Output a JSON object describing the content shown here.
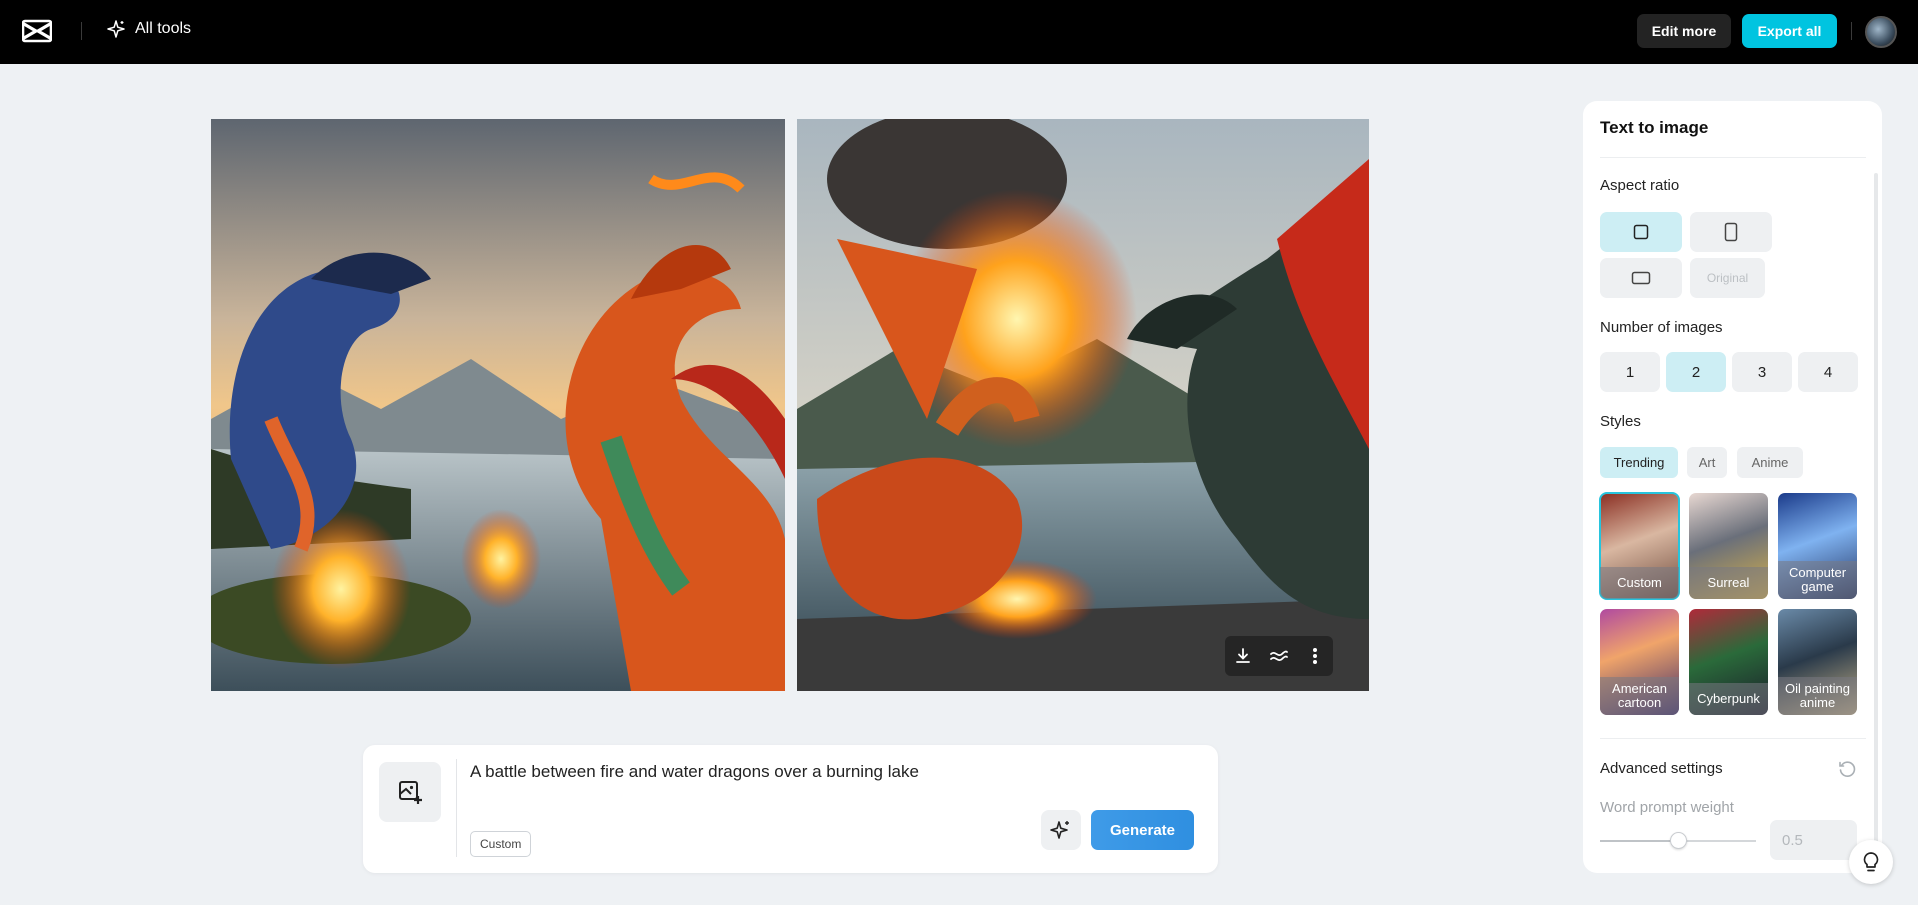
{
  "topbar": {
    "logo_icon": "capcut-logo-icon",
    "all_tools_label": "All tools",
    "edit_more_label": "Edit more",
    "export_all_label": "Export all"
  },
  "prompt": {
    "text": "A battle between fire and water dragons over a burning lake",
    "style_chip": "Custom",
    "generate_label": "Generate"
  },
  "panel": {
    "title": "Text to image",
    "aspect_ratio_label": "Aspect ratio",
    "aspect_options": [
      {
        "icon": "square-ratio-icon",
        "selected": true
      },
      {
        "icon": "portrait-ratio-icon",
        "selected": false
      },
      {
        "icon": "landscape-ratio-icon",
        "selected": false
      },
      {
        "label": "Original",
        "disabled": true
      }
    ],
    "number_of_images_label": "Number of images",
    "numbers": [
      "1",
      "2",
      "3",
      "4"
    ],
    "selected_number": "2",
    "styles_label": "Styles",
    "style_tabs": [
      "Trending",
      "Art",
      "Anime"
    ],
    "selected_tab": "Trending",
    "styles": [
      {
        "label": "Custom",
        "selected": true
      },
      {
        "label": "Surreal",
        "selected": false
      },
      {
        "label": "Computer game",
        "selected": false
      },
      {
        "label": "American cartoon",
        "selected": false
      },
      {
        "label": "Cyberpunk",
        "selected": false
      },
      {
        "label": "Oil painting anime",
        "selected": false
      }
    ],
    "advanced_label": "Advanced settings",
    "word_prompt_weight_label": "Word prompt weight",
    "word_prompt_weight_value": "0.5",
    "word_prompt_weight_fraction": 0.5
  },
  "colors": {
    "accent": "#00c4e0",
    "selected_bg": "#cdeef4",
    "generate": "#3f9be8"
  }
}
